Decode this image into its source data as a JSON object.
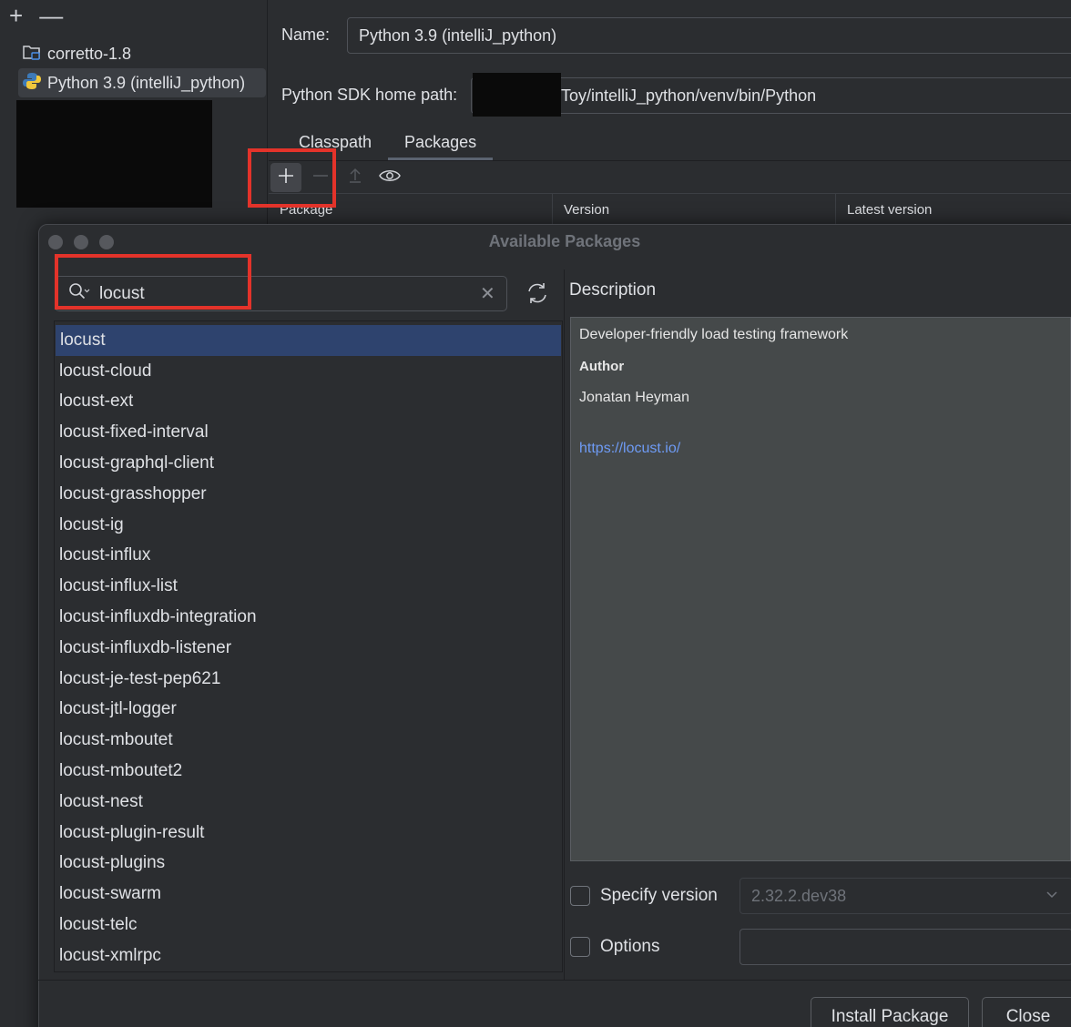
{
  "sdk_list": {
    "toolbar": {
      "add": "+",
      "remove": "—"
    },
    "items": [
      {
        "label": "corretto-1.8",
        "icon": "folder-icon"
      },
      {
        "label": "Python 3.9 (intelliJ_python)",
        "icon": "python-icon"
      }
    ]
  },
  "sdk_form": {
    "name_label": "Name:",
    "name_value": "Python 3.9 (intelliJ_python)",
    "path_label": "Python SDK home path:",
    "path_value": "Toy/intelliJ_python/venv/bin/Python",
    "tabs": [
      {
        "label": "Classpath"
      },
      {
        "label": "Packages"
      }
    ],
    "table_headers": {
      "package": "Package",
      "version": "Version",
      "latest": "Latest version"
    }
  },
  "dialog": {
    "title": "Available Packages",
    "search_value": "locust",
    "packages": [
      "locust",
      "locust-cloud",
      "locust-ext",
      "locust-fixed-interval",
      "locust-graphql-client",
      "locust-grasshopper",
      "locust-ig",
      "locust-influx",
      "locust-influx-list",
      "locust-influxdb-integration",
      "locust-influxdb-listener",
      "locust-je-test-pep621",
      "locust-jtl-logger",
      "locust-mboutet",
      "locust-mboutet2",
      "locust-nest",
      "locust-plugin-result",
      "locust-plugins",
      "locust-swarm",
      "locust-telc",
      "locust-xmlrpc"
    ],
    "description": {
      "label": "Description",
      "text": "Developer-friendly load testing framework",
      "author_label": "Author",
      "author": "Jonatan Heyman",
      "link": "https://locust.io/"
    },
    "specify_version_label": "Specify version",
    "version_value": "2.32.2.dev38",
    "options_label": "Options",
    "install_button": "Install Package",
    "close_button": "Close"
  },
  "colors": {
    "background": "#2b2d30",
    "selection": "#2e436e",
    "description_bg": "#45494a",
    "link": "#6e9bf5",
    "highlight_box": "#e3332a"
  }
}
